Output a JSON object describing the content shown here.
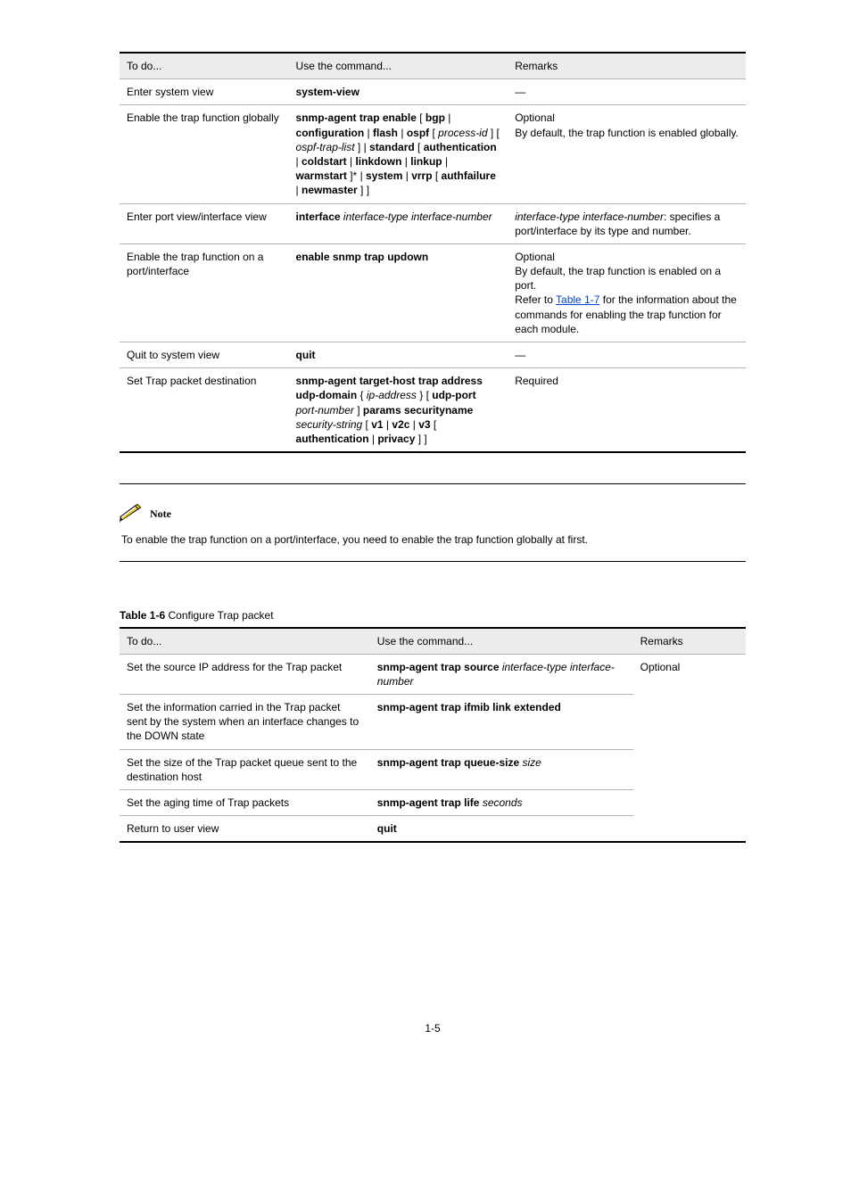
{
  "table1": {
    "headers": [
      "To do...",
      "Use the command...",
      "Remarks"
    ],
    "rows": [
      {
        "c1_pre": "Enter system view",
        "c2": {
          "cmd": "system-view"
        },
        "c3_plain": "—"
      },
      {
        "c1_pre": "Enable the trap function globally",
        "c2": {
          "cmd_a": "snmp-agent trap enable",
          "tail_a": " [ ",
          "cmd_b": "bgp",
          "tail_b": " | ",
          "cmd_c": "configuration",
          "tail_c": " | ",
          "cmd_d": "flash",
          "tail_d": " | ",
          "cmd_e": "ospf",
          "tail_e": " [ ",
          "param_a": "process-id",
          "tail_f": " ] [ ",
          "param_b": "ospf-trap-list",
          "tail_g": " ] | ",
          "cmd_f": "standard",
          "tail_h": " [ ",
          "cmd_g": "authentication",
          "tail_i": " | ",
          "cmd_h": "coldstart",
          "tail_j": " | ",
          "cmd_i": "linkdown",
          "tail_k": " | ",
          "cmd_j": "linkup",
          "tail_l": " | ",
          "cmd_k": "warmstart",
          "tail_m": " ]* | ",
          "cmd_l": "system",
          "tail_n": " | ",
          "cmd_m": "vrrp",
          "tail_o": " [ ",
          "cmd_n": "authfailure",
          "tail_p": " | ",
          "cmd_o": "newmaster",
          "tail_q": " ] ]"
        },
        "c3_plain": "Optional\nBy default, the trap function is enabled globally."
      },
      {
        "c1_pre": "Enter port view/interface view",
        "c2": {
          "cmd_a": "interface",
          "tail_a": " ",
          "param_a": "interface-type interface-number"
        },
        "c3_pre": "interface-type interface-number",
        "c3_pre_italic": true,
        "c3_tail": ": specifies a port/interface by its type and number."
      },
      {
        "c1_pre": "Enable the trap function on a port/interface",
        "c2": {
          "cmd_a": "enable snmp trap updown"
        },
        "c3_plain": "Optional\nBy default, the trap function is enabled on a port.\nRefer to ",
        "c3_link": "Table 1-7",
        "c3_after_link": " for the information about the commands for enabling the trap function for each module."
      },
      {
        "c1_pre": "Quit to system view",
        "c2": {
          "cmd_a": "quit"
        },
        "c3_plain": "—"
      },
      {
        "c1_pre": "Set Trap packet destination",
        "c2": {
          "cmd_a": "snmp-agent target-host trap address udp-domain",
          "tail_a": " { ",
          "param_a": "ip-address",
          "tail_b": " } [ ",
          "cmd_b": "udp-port",
          "tail_c": " ",
          "param_b": "port-number",
          "tail_d": " ] ",
          "cmd_c": "params securityname",
          "tail_e": " ",
          "param_c": "security-string",
          "tail_f": " [ ",
          "cmd_d": "v1",
          "tail_g": " | ",
          "cmd_e": "v2c",
          "tail_h": " | ",
          "cmd_f": "v3",
          "tail_i": " [ ",
          "cmd_g": "authentication",
          "tail_j": " | ",
          "cmd_h": "privacy",
          "tail_k": " ] ]"
        },
        "c3_plain": "Required"
      }
    ]
  },
  "note": {
    "label": "Note",
    "text": "To enable the trap function on a port/interface, you need to enable the trap function globally at first."
  },
  "table2": {
    "caption_strong": "Table 1-6",
    "caption_tail": " Configure Trap packet",
    "headers": [
      "To do...",
      "Use the command...",
      "Remarks"
    ],
    "col3_merged": "Optional",
    "rows": [
      {
        "c1": "Set the source IP address for the Trap packet",
        "c2": {
          "cmd_a": "snmp-agent trap source",
          "tail_a": " ",
          "param_a": "interface-type interface-number"
        }
      },
      {
        "c1": "Set the information carried in the Trap packet sent by the system when an interface changes to the DOWN state",
        "c2": {
          "cmd_a": "snmp-agent trap ifmib link extended"
        }
      },
      {
        "c1": "Set the size of the Trap packet queue sent to the destination host",
        "c2": {
          "cmd_a": "snmp-agent trap queue-size",
          "tail_a": " ",
          "param_a": "size"
        }
      },
      {
        "c1": "Set the aging time of Trap packets",
        "c2": {
          "cmd_a": "snmp-agent trap life",
          "tail_a": " ",
          "param_a": "seconds"
        }
      },
      {
        "c1": "Return to user view",
        "c2": {
          "cmd_a": "quit"
        }
      }
    ]
  },
  "page_number": "1-5"
}
